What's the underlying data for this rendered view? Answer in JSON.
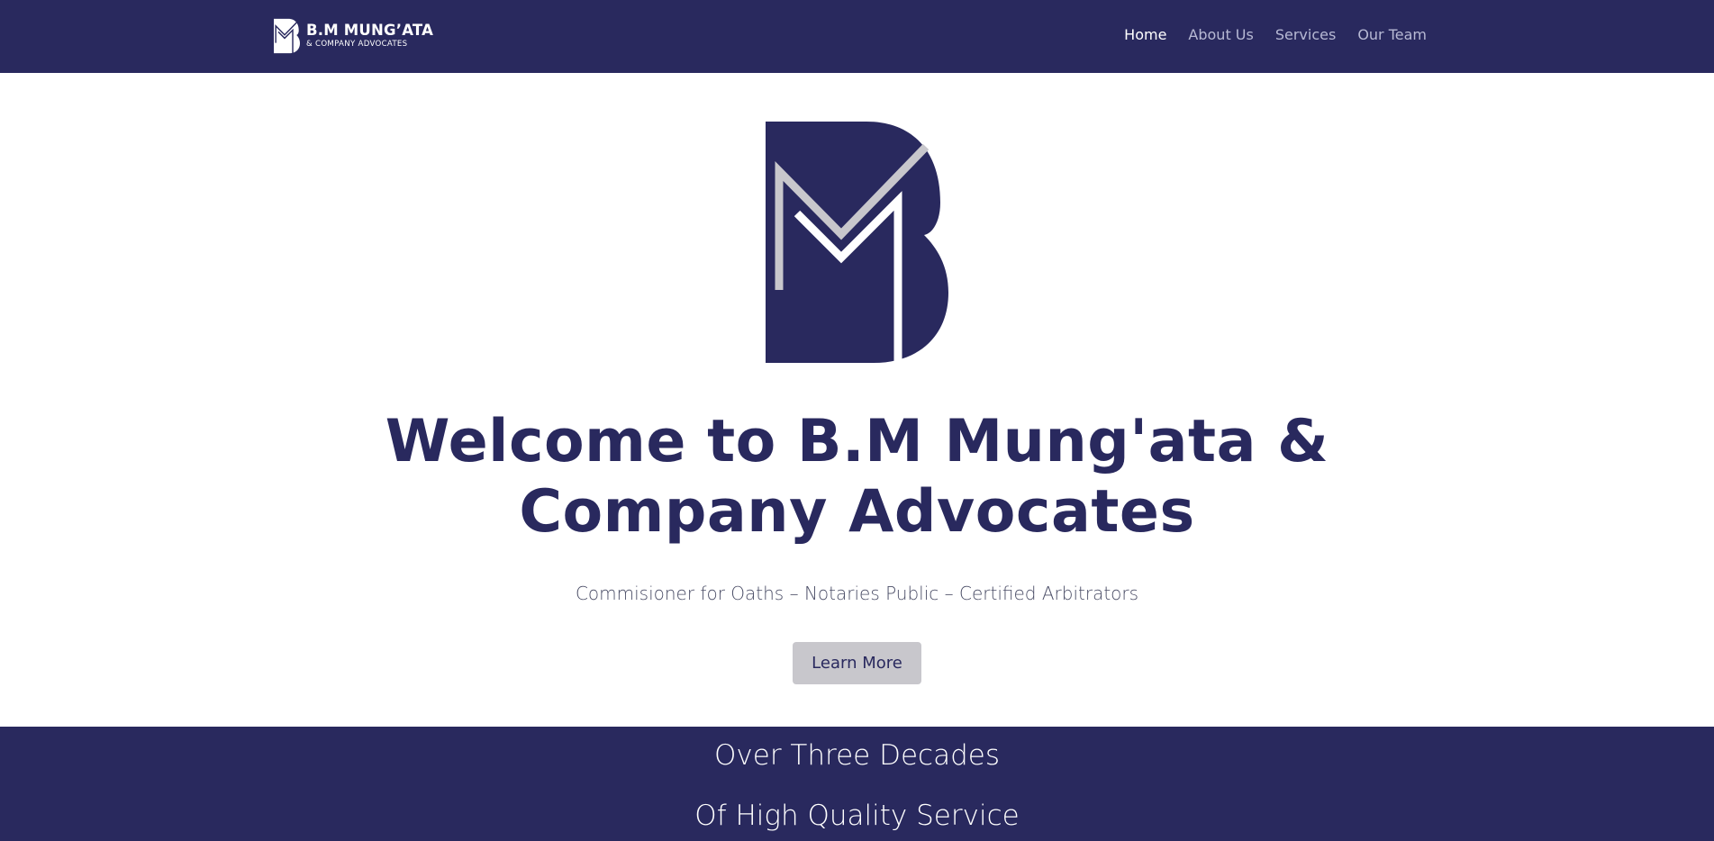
{
  "colors": {
    "brand_navy": "#29295e",
    "logo_stripe": "#c8c7cc",
    "button_bg": "#c8c7cc",
    "white": "#ffffff"
  },
  "header": {
    "brand_name": "B.M MUNG’ATA",
    "brand_sub": "& COMPANY ADVOCATES",
    "nav": [
      {
        "label": "Home",
        "active": true
      },
      {
        "label": "About Us",
        "active": false
      },
      {
        "label": "Services",
        "active": false
      },
      {
        "label": "Our Team",
        "active": false
      }
    ]
  },
  "hero": {
    "logo_icon": "bm-monogram-logo",
    "title_line1": "Welcome to B.M Mung'ata &",
    "title_line2": "Company Advocates",
    "subtitle": "Commisioner for Oaths – Notaries Public – Certified Arbitrators",
    "cta_label": "Learn More"
  },
  "band": {
    "line1": "Over Three Decades",
    "line2": "Of High Quality Service"
  }
}
